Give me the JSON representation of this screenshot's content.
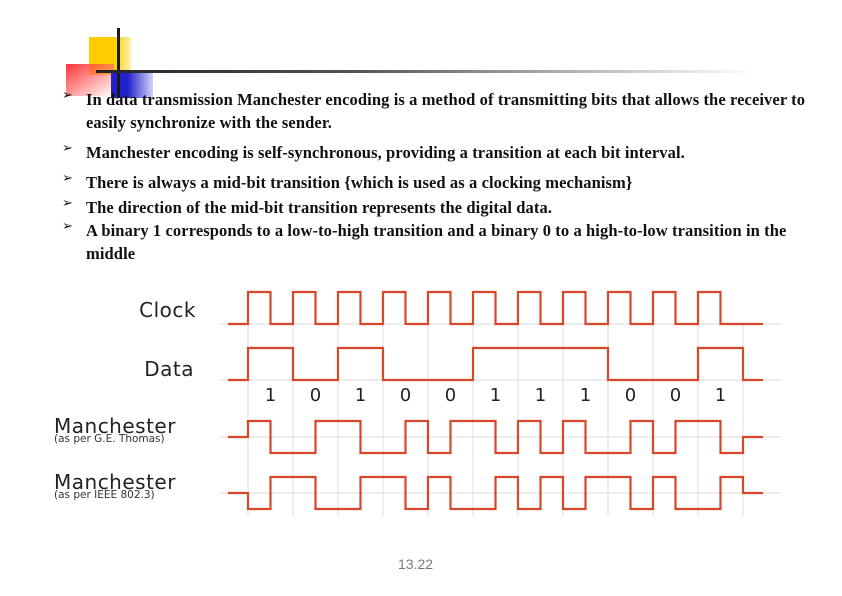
{
  "slide": {
    "page_number": "13.22",
    "bullet_icon": "arrow-bullet-icon",
    "bullet_glyph": "➢",
    "bullets": [
      {
        "text": "In data transmission Manchester encoding is a method of transmitting  bits that allows the receiver to easily synchronize with the sender."
      },
      {
        "text": "Manchester encoding is self-synchronous, providing a transition at each bit interval."
      },
      {
        "text": " There is always a mid-bit transition {which is used as a clocking mechanism}"
      },
      {
        "text": " The direction of the mid-bit transition represents the digital data."
      },
      {
        "text": "A binary 1 corresponds to a low-to-high transition and a binary 0 to a high-to-low transition in the middle"
      }
    ]
  },
  "diagram": {
    "signal_color": "#d9472b",
    "grid_color": "#e2e2e2",
    "signals": [
      {
        "label": "Clock",
        "sublabel": ""
      },
      {
        "label": "Data",
        "sublabel": ""
      },
      {
        "label": "Manchester",
        "sublabel": "(as per G.E. Thomas)"
      },
      {
        "label": "Manchester",
        "sublabel": "(as per IEEE 802.3)"
      }
    ],
    "bits": [
      "1",
      "0",
      "1",
      "0",
      "0",
      "1",
      "1",
      "1",
      "0",
      "0",
      "1"
    ]
  }
}
